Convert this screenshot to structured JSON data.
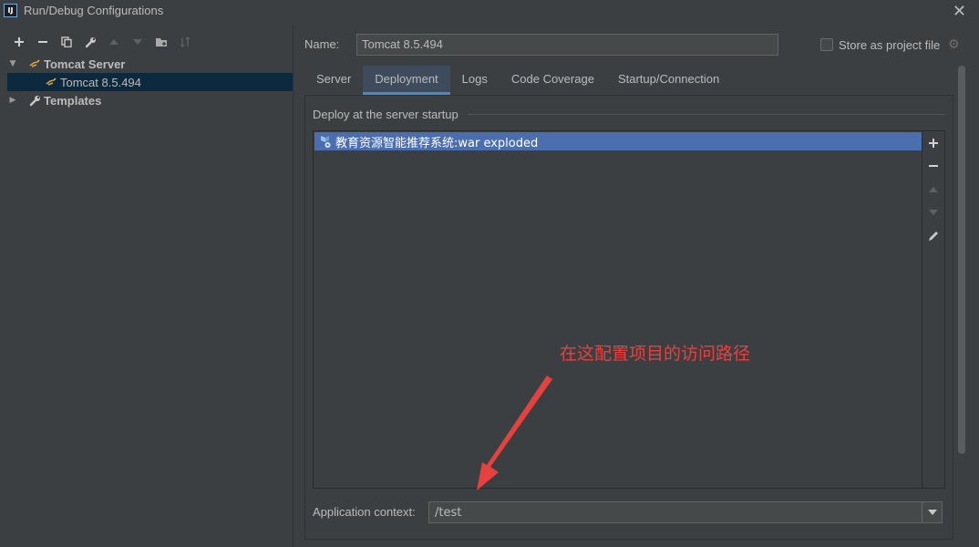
{
  "window": {
    "title": "Run/Debug Configurations",
    "app_icon_text": "IJ"
  },
  "toolbar": {
    "buttons": [
      "add-icon",
      "remove-icon",
      "copy-icon",
      "wrench-icon",
      "move-up-icon",
      "move-down-icon",
      "new-folder-icon",
      "sort-icon"
    ]
  },
  "tree": {
    "group_label": "Tomcat Server",
    "child_label": "Tomcat 8.5.494",
    "templates_label": "Templates"
  },
  "config": {
    "name_label": "Name:",
    "name_value": "Tomcat 8.5.494",
    "store_label": "Store as project file",
    "store_checked": false
  },
  "tabs": [
    {
      "label": "Server",
      "active": false
    },
    {
      "label": "Deployment",
      "active": true
    },
    {
      "label": "Logs",
      "active": false
    },
    {
      "label": "Code Coverage",
      "active": false
    },
    {
      "label": "Startup/Connection",
      "active": false
    }
  ],
  "deployment": {
    "section_title": "Deploy at the server startup",
    "items": [
      "教育资源智能推荐系统:war exploded"
    ],
    "side_buttons": [
      "add-icon",
      "remove-icon",
      "move-up-icon",
      "move-down-icon",
      "edit-icon"
    ]
  },
  "context": {
    "label": "Application context:",
    "value": "/test"
  },
  "annotation": {
    "text": "在这配置项目的访问路径",
    "color": "#e5423f"
  },
  "colors": {
    "background": "#3c3f41",
    "selection": "#4b6eaf",
    "tab_accent": "#4a88c7"
  }
}
